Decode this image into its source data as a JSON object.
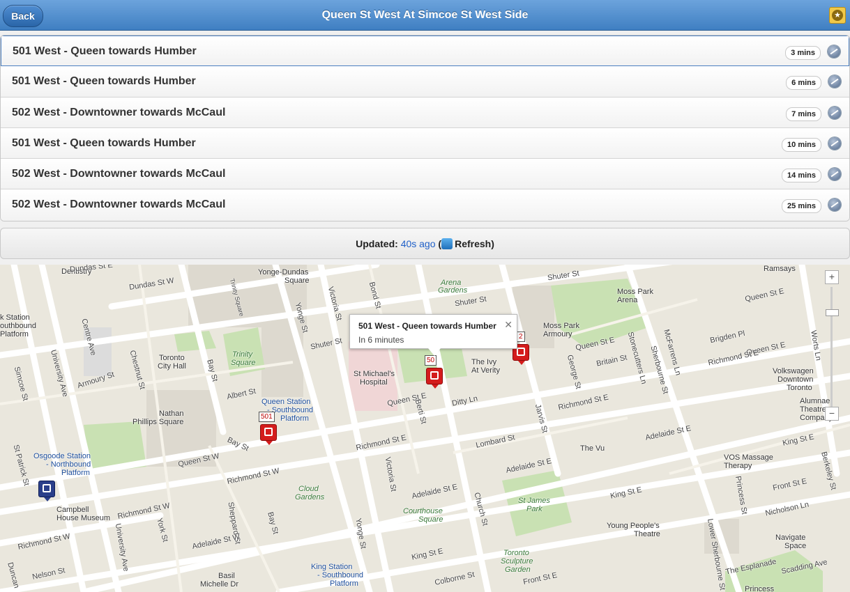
{
  "header": {
    "title": "Queen St West At Simcoe St West Side",
    "back_label": "Back",
    "favorite_icon": "star-icon"
  },
  "arrivals": [
    {
      "route": "501 West - Queen towards Humber",
      "eta": "3 mins"
    },
    {
      "route": "501 West - Queen towards Humber",
      "eta": "6 mins"
    },
    {
      "route": "502 West - Downtowner towards McCaul",
      "eta": "7 mins"
    },
    {
      "route": "501 West - Queen towards Humber",
      "eta": "10 mins"
    },
    {
      "route": "502 West - Downtowner towards McCaul",
      "eta": "14 mins"
    },
    {
      "route": "502 West - Downtowner towards McCaul",
      "eta": "25 mins"
    }
  ],
  "updated": {
    "label": "Updated:",
    "ago": "40s ago",
    "open_paren": "(",
    "refresh": "Refresh)"
  },
  "map": {
    "infowindow": {
      "title": "501 West - Queen towards Humber",
      "subtitle": "In 6 minutes",
      "close": "✕"
    },
    "markers": [
      {
        "tag": "501"
      },
      {
        "tag": "50"
      },
      {
        "tag": "2"
      }
    ],
    "zoom_in": "+",
    "zoom_out": "−",
    "labels": {
      "dentistry": "Dentistry",
      "dundas": "Dundas St W",
      "yonge_dundas": "Yonge-Dundas",
      "square": "Square",
      "trinity_sq_st": "Trinity Square",
      "victoria": "Victoria St",
      "bond": "Bond St",
      "arena": "Arena",
      "gardens": "Gardens",
      "shuter": "Shuter St",
      "shuter2": "Shuter St",
      "moss_park_arena": "Moss Park",
      "arena2": "Arena",
      "ramsays": "Ramsays",
      "queen_e1": "Queen St E",
      "queen_e2": "Queen St E",
      "st_station": "k Station",
      "outhbound": "outhbound",
      "platform_left": "Platform",
      "university": "University Ave",
      "centre_ave": "Centre Ave",
      "chestnut": "Chestnut St",
      "armoury": "Armoury St",
      "toronto_city_hall": "Toronto",
      "city_hall": "City Hall",
      "bay_st": "Bay St",
      "trinity_square": "Trinity",
      "trinity_square2": "Square",
      "albert": "Albert St",
      "shuter3": "Shuter St",
      "st_michaels": "St Michael's",
      "hospital": "Hospital",
      "ivy": "The Ivy",
      "verity": "At Verity",
      "moss_park_armoury": "Moss Park",
      "armoury2": "Armoury",
      "george": "George St",
      "britain": "Britain St",
      "stonecutters": "Stonecutters Ln",
      "sherbourne": "Sherbourne St",
      "mcfarrens": "McFarrens Ln",
      "brigden": "Brigden Pl",
      "queen_e3": "Queen St E",
      "richmond_e_right": "Richmond St E",
      "worts": "Worts Ln",
      "volkswagen": "Volkswagen",
      "downtown": "Downtown",
      "toronto2": "Toronto",
      "simcoe": "Simcoe St",
      "nathan": "Nathan",
      "phillips": "Phillips Square",
      "qs_station": "Queen Station",
      "qs_south": "- Southbound",
      "qs_platform": "Platform",
      "queen_e4": "Queen St E",
      "ditty": "Ditty Ln",
      "berti": "Berti St",
      "jarvis": "Jarvis St",
      "richmond_e2": "Richmond St E",
      "alumnae": "Alumnae",
      "theatre": "Theatre",
      "company": "Company",
      "bay_st2": "Bay St",
      "richmond_e3": "Richmond St E",
      "lombard": "Lombard St",
      "the_vu": "The Vu",
      "adelaide_e1": "Adelaide St E",
      "king_e1": "King St E",
      "st_patrick": "St Patrick St",
      "osgoode": "Osgoode Station",
      "osgoode2": "- Northbound",
      "osgoode3": "Platform",
      "queen_w": "Queen St W",
      "richmond_w1": "Richmond St W",
      "cloud": "Cloud",
      "cloud2": "Gardens",
      "victoria2": "Victoria St",
      "adelaide_e2": "Adelaide St E",
      "church": "Church St",
      "adelaide_e3": "Adelaide St E",
      "vos": "VOS Massage",
      "therapy": "Therapy",
      "berkeley": "Berkeley St",
      "front_e": "Front St E",
      "campbell": "Campbell",
      "house": "House Museum",
      "richmond_w2": "Richmond St W",
      "york": "York St",
      "sheppard": "Sheppard St",
      "bay3": "Bay St",
      "adelaide_e4": "Adelaide St E",
      "courthouse": "Courthouse",
      "square3": "Square",
      "st_james": "St James",
      "park": "Park",
      "king_e2": "King St E",
      "princess": "Princess St",
      "nicholson": "Nicholson Ln",
      "richmond_w3": "Richmond St W",
      "adelaide_w": "Adelaide St W",
      "yonge": "Yonge St",
      "yonge2": "Yonge St",
      "young_people": "Young People's",
      "theatre2": "Theatre",
      "lower_sherbourne": "Lower Sherbourne St",
      "navigate": "Navigate",
      "space": "Space",
      "duncan": "Duncan",
      "nelson": "Nelson St",
      "basil": "Basil",
      "michelle": "Michelle Dr",
      "king_station": "King Station",
      "king_south": "- Southbound",
      "king_platform": "Platform",
      "king_e3": "King St E",
      "colborne": "Colborne St",
      "tsg": "Toronto",
      "tsg2": "Sculpture",
      "tsg3": "Garden",
      "front_e2": "Front St E",
      "esplanade": "The Esplanade",
      "scadding": "Scadding Ave",
      "princess2": "Princess",
      "university2": "University Ave",
      "dundas_e": "Dundas St E"
    }
  }
}
